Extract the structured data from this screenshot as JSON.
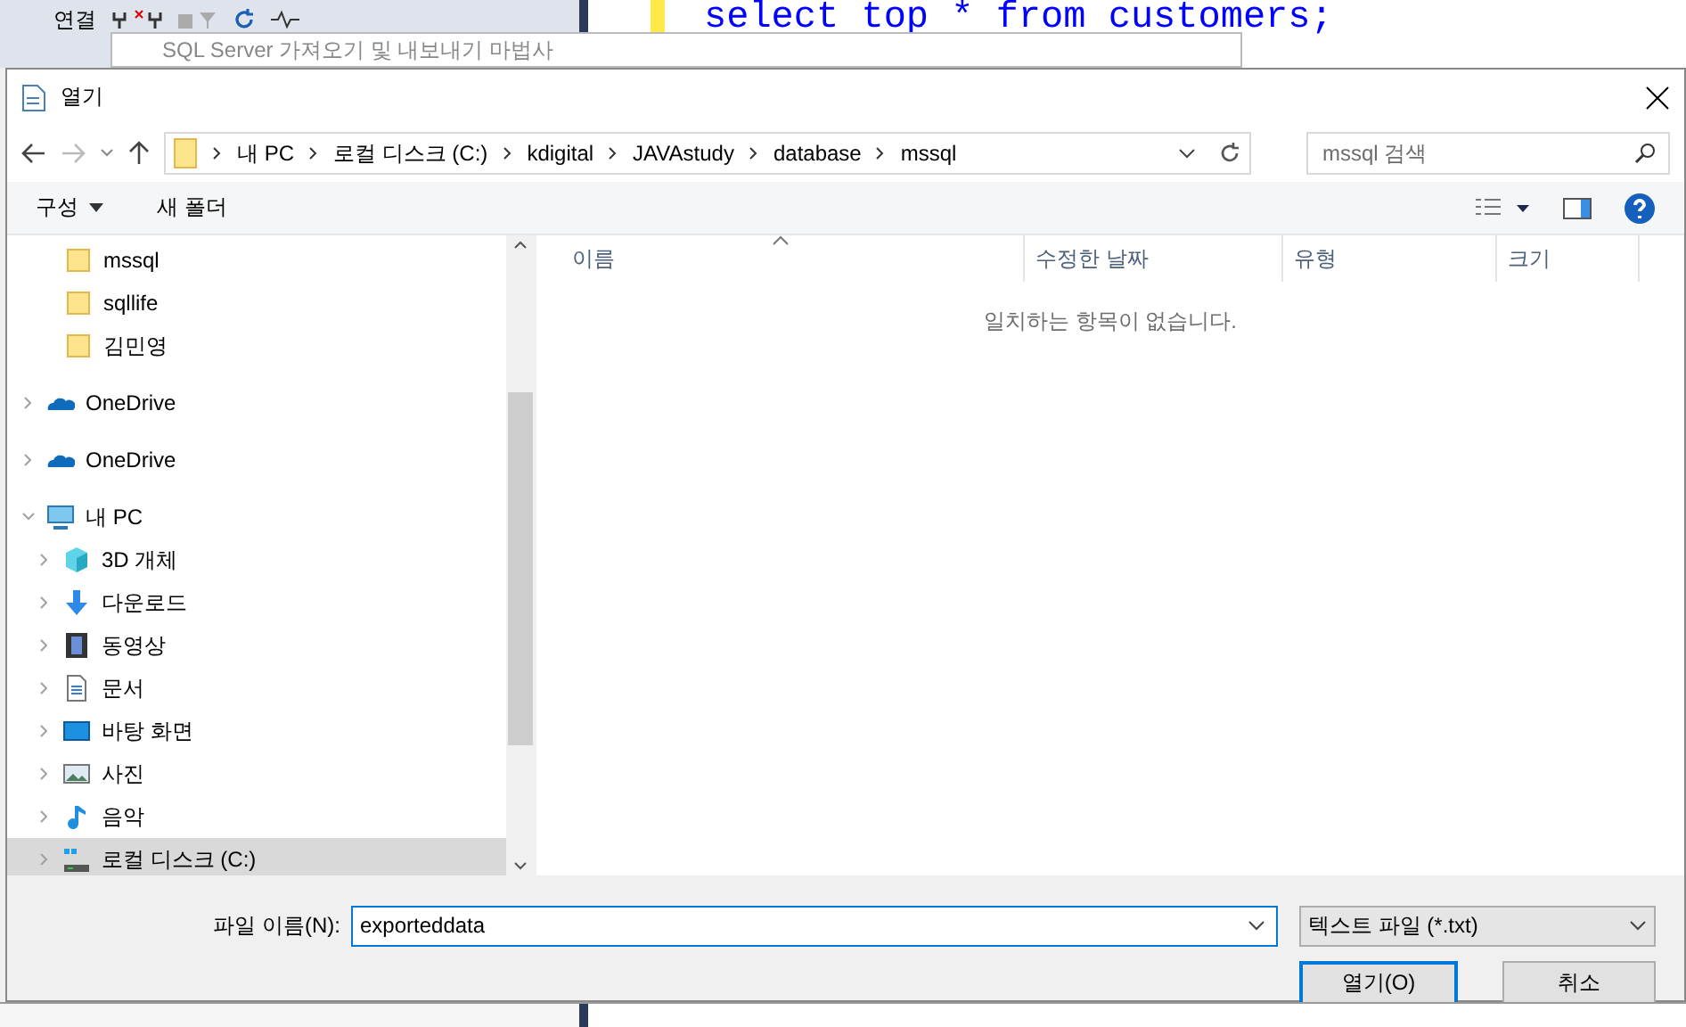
{
  "background_app": {
    "toolbar_label": "연결",
    "code": "select top * from customers;",
    "wizard_title": "SQL Server 가져오기 및 내보내기 마법사"
  },
  "dialog": {
    "title": "열기"
  },
  "address_bar": {
    "path": [
      "내 PC",
      "로컬 디스크 (C:)",
      "kdigital",
      "JAVAstudy",
      "database",
      "mssql"
    ]
  },
  "search": {
    "placeholder": "mssql 검색"
  },
  "command_bar": {
    "organize": "구성",
    "new_folder": "새 폴더"
  },
  "nav": {
    "items": [
      {
        "label": "mssql",
        "kind": "folder",
        "selected": false
      },
      {
        "label": "sqllife",
        "kind": "folder",
        "selected": false
      },
      {
        "label": "김민영",
        "kind": "folder",
        "selected": false
      },
      {
        "label": "OneDrive",
        "kind": "cloud",
        "selected": false,
        "expanded": false
      },
      {
        "label": "OneDrive",
        "kind": "cloud",
        "selected": false,
        "expanded": false
      },
      {
        "label": "내 PC",
        "kind": "pc",
        "selected": false,
        "expanded": true,
        "children": [
          {
            "label": "3D 개체",
            "kind": "cube",
            "selected": false,
            "expanded": false
          },
          {
            "label": "다운로드",
            "kind": "download",
            "selected": false,
            "expanded": false
          },
          {
            "label": "동영상",
            "kind": "video",
            "selected": false,
            "expanded": false
          },
          {
            "label": "문서",
            "kind": "document",
            "selected": false,
            "expanded": false
          },
          {
            "label": "바탕 화면",
            "kind": "desktop",
            "selected": false,
            "expanded": false
          },
          {
            "label": "사진",
            "kind": "image",
            "selected": false,
            "expanded": false
          },
          {
            "label": "음악",
            "kind": "music",
            "selected": false,
            "expanded": false
          },
          {
            "label": "로컬 디스크 (C:)",
            "kind": "drive",
            "selected": true,
            "expanded": false
          }
        ]
      }
    ]
  },
  "columns": [
    {
      "label": "이름",
      "sorted": true
    },
    {
      "label": "수정한 날짜",
      "sorted": false
    },
    {
      "label": "유형",
      "sorted": false
    },
    {
      "label": "크기",
      "sorted": false
    }
  ],
  "empty_message": "일치하는 항목이 없습니다.",
  "file_name": {
    "label": "파일 이름(N):",
    "value": "exporteddata"
  },
  "file_type": {
    "value": "텍스트 파일 (*.txt)"
  },
  "buttons": [
    {
      "label": "열기(O)",
      "default": true
    },
    {
      "label": "취소",
      "default": false
    }
  ]
}
